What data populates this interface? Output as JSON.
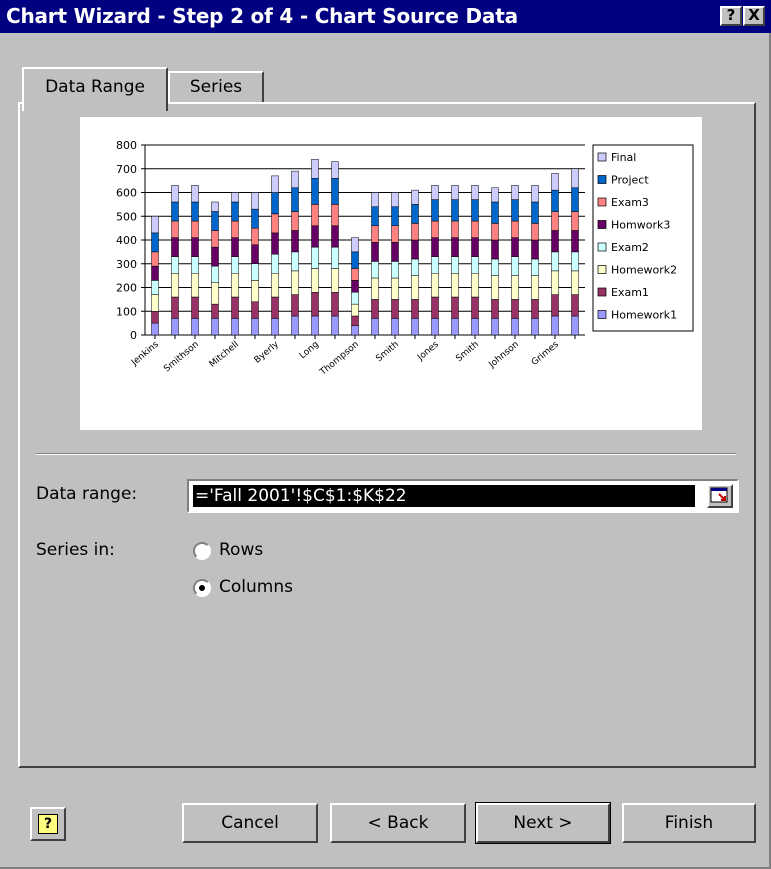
{
  "window": {
    "title": "Chart Wizard - Step 2 of 4 - Chart Source Data",
    "help_glyph": "?",
    "close_glyph": "X"
  },
  "tabs": [
    {
      "label": "Data Range",
      "active": true
    },
    {
      "label": "Series",
      "active": false
    }
  ],
  "data_range": {
    "label": "Data range:",
    "value": "='Fall 2001'!$C$1:$K$22"
  },
  "series_in": {
    "label": "Series in:",
    "options": [
      {
        "label": "Rows",
        "selected": false
      },
      {
        "label": "Columns",
        "selected": true
      }
    ]
  },
  "buttons": {
    "help": "?",
    "cancel": "Cancel",
    "back": "< Back",
    "next": "Next >",
    "finish": "Finish"
  },
  "icons": {
    "title_help": "help-icon",
    "title_close": "close-icon",
    "collapse": "collapse-dialog-icon",
    "help_button": "help-icon"
  },
  "colors": {
    "title_bar": "#000080",
    "dialog_bg": "#c0c0c0",
    "selection": "#000000"
  },
  "chart_data": {
    "type": "bar",
    "stacked": true,
    "ylim": [
      0,
      800
    ],
    "yticks": [
      0,
      100,
      200,
      300,
      400,
      500,
      600,
      700,
      800
    ],
    "grid": true,
    "legend_position": "right",
    "categories": [
      "Jenkins",
      "",
      "Smithson",
      "",
      "Mitchell",
      "",
      "Byerly",
      "",
      "Long",
      "",
      "Thompson",
      "",
      "Smith",
      "",
      "Jones",
      "",
      "Smith",
      "",
      "Johnson",
      "",
      "Grimes",
      ""
    ],
    "series": [
      {
        "name": "Homework1",
        "color": "#9999ff",
        "values": [
          50,
          70,
          70,
          70,
          70,
          70,
          70,
          80,
          80,
          80,
          40,
          70,
          70,
          70,
          70,
          70,
          70,
          70,
          70,
          70,
          80,
          80
        ]
      },
      {
        "name": "Exam1",
        "color": "#993366",
        "values": [
          50,
          90,
          90,
          60,
          90,
          70,
          90,
          90,
          100,
          100,
          40,
          80,
          80,
          80,
          90,
          90,
          90,
          80,
          80,
          80,
          90,
          90
        ]
      },
      {
        "name": "Homework2",
        "color": "#ffffcc",
        "values": [
          70,
          100,
          100,
          90,
          100,
          90,
          100,
          100,
          100,
          100,
          50,
          90,
          90,
          100,
          100,
          100,
          100,
          100,
          100,
          100,
          100,
          100
        ]
      },
      {
        "name": "Exam2",
        "color": "#ccffff",
        "values": [
          60,
          70,
          70,
          70,
          70,
          70,
          80,
          80,
          90,
          90,
          50,
          70,
          70,
          70,
          70,
          70,
          70,
          70,
          80,
          70,
          80,
          80
        ]
      },
      {
        "name": "Homwork3",
        "color": "#660066",
        "values": [
          60,
          80,
          80,
          80,
          80,
          80,
          90,
          90,
          90,
          90,
          50,
          80,
          80,
          80,
          80,
          80,
          80,
          80,
          80,
          80,
          90,
          90
        ]
      },
      {
        "name": "Exam3",
        "color": "#ff8080",
        "values": [
          60,
          70,
          70,
          70,
          70,
          70,
          80,
          80,
          90,
          90,
          50,
          70,
          70,
          70,
          70,
          70,
          70,
          70,
          70,
          70,
          80,
          80
        ]
      },
      {
        "name": "Project",
        "color": "#0066cc",
        "values": [
          80,
          80,
          80,
          80,
          80,
          80,
          90,
          100,
          110,
          110,
          70,
          80,
          80,
          80,
          90,
          90,
          90,
          90,
          90,
          90,
          90,
          100
        ]
      },
      {
        "name": "Final",
        "color": "#ccccff",
        "values": [
          70,
          70,
          70,
          40,
          40,
          70,
          70,
          70,
          80,
          70,
          60,
          60,
          60,
          60,
          60,
          60,
          60,
          60,
          60,
          70,
          70,
          80
        ]
      }
    ]
  }
}
